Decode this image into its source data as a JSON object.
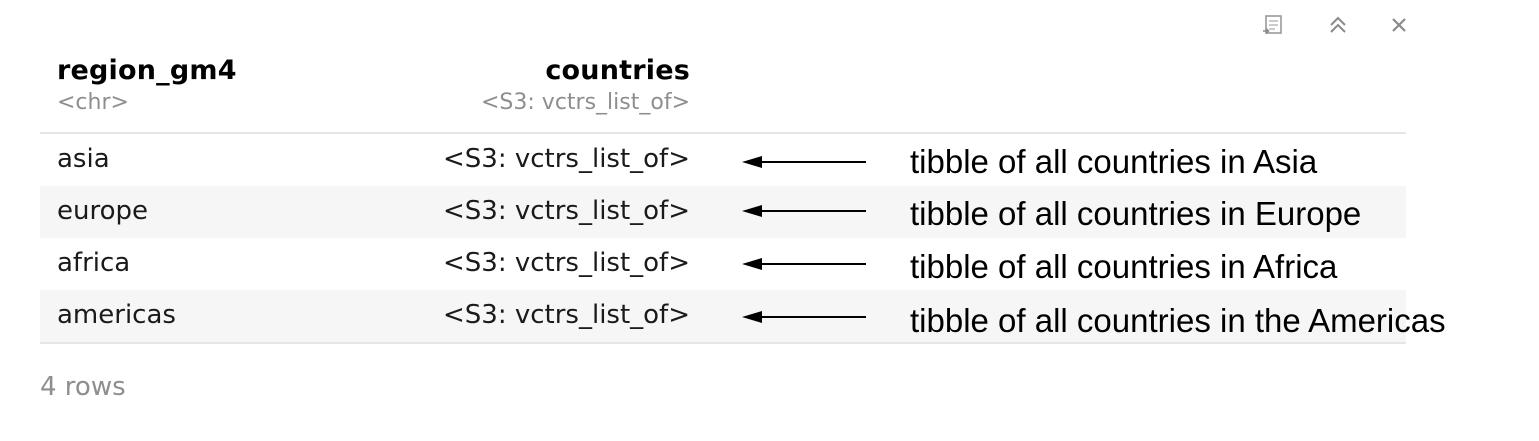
{
  "toolbar": {
    "icons": [
      "export-icon",
      "collapse-up-icon",
      "close-icon"
    ]
  },
  "table": {
    "columns": [
      {
        "name": "region_gm4",
        "type": "<chr>"
      },
      {
        "name": "countries",
        "type": "<S3: vctrs_list_of>"
      }
    ],
    "rows": [
      {
        "region_gm4": "asia",
        "countries": "<S3: vctrs_list_of>"
      },
      {
        "region_gm4": "europe",
        "countries": "<S3: vctrs_list_of>"
      },
      {
        "region_gm4": "africa",
        "countries": "<S3: vctrs_list_of>"
      },
      {
        "region_gm4": "americas",
        "countries": "<S3: vctrs_list_of>"
      }
    ],
    "footer": "4 rows"
  },
  "annotations": [
    "tibble of all countries in Asia",
    "tibble of all countries in Europe",
    "tibble of all countries in Africa",
    "tibble of all countries in the Americas"
  ]
}
